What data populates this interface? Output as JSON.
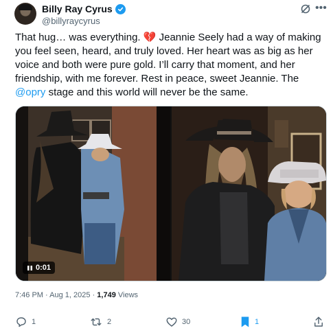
{
  "author": {
    "name": "Billy Ray Cyrus",
    "handle": "@billyraycyrus"
  },
  "tweet": {
    "text_before": "That hug… was everything. ",
    "emoji": "💔",
    "text_middle": " Jeannie Seely had a way of making you feel seen, heard, and truly loved. Her heart was as big as her voice and both were pure gold. I’ll carry that moment, and her friendship, with me forever. Rest in peace, sweet Jeannie. The ",
    "mention": "@opry",
    "text_after": " stage and this world will never be the same."
  },
  "media": {
    "video_duration": "0:01"
  },
  "meta": {
    "time": "7:46 PM",
    "separator": "·",
    "date": "Aug 1, 2025",
    "views_count": "1,749",
    "views_label": "Views"
  },
  "actions": {
    "replies": "1",
    "reposts": "2",
    "likes": "30",
    "bookmarks": "1"
  },
  "colors": {
    "accent": "#1d9bf0",
    "secondary_text": "#536471"
  }
}
